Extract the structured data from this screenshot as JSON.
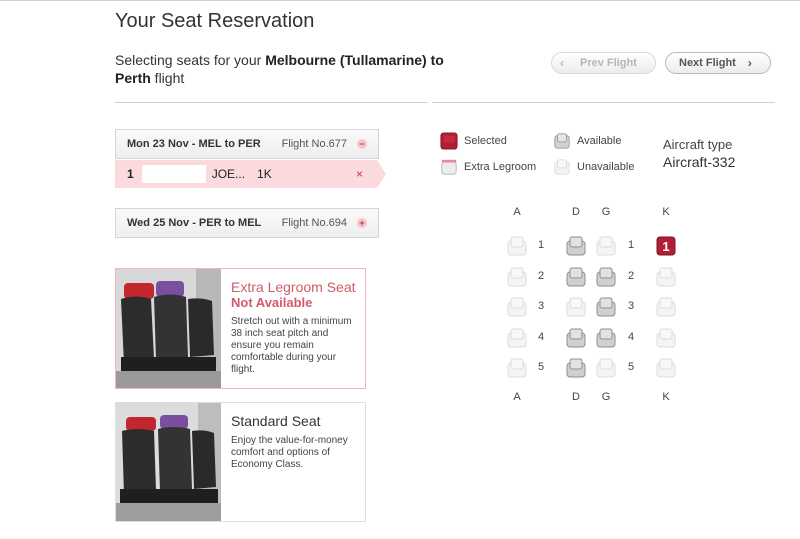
{
  "header": {
    "title": "Your Seat Reservation",
    "route_prefix": "Selecting seats for your ",
    "route_bold": "Melbourne (Tullamarine) to Perth",
    "route_suffix": " flight"
  },
  "nav": {
    "prev_label": "Prev Flight",
    "next_label": "Next Flight"
  },
  "flights": [
    {
      "route": "Mon 23 Nov - MEL to PER",
      "flight_no": "Flight No.677",
      "toggle": "−",
      "expanded": true
    },
    {
      "route": "Wed 25 Nov - PER to MEL",
      "flight_no": "Flight No.694",
      "toggle": "+",
      "expanded": false
    }
  ],
  "passenger": {
    "number": "1",
    "name": "JOE...",
    "seat": "1K",
    "remove": "×"
  },
  "cards": {
    "extra": {
      "title": "Extra Legroom Seat",
      "subtitle": "Not Available",
      "description": "Stretch out with a minimum 38 inch seat pitch and ensure you remain comfortable during your flight."
    },
    "standard": {
      "title": "Standard Seat",
      "description": "Enjoy the value-for-money comfort and options of Economy Class."
    }
  },
  "legend": {
    "selected": "Selected",
    "available": "Available",
    "extra_legroom": "Extra Legroom",
    "unavailable": "Unavailable"
  },
  "aircraft": {
    "label": "Aircraft type",
    "value": "Aircraft-332"
  },
  "seat_map": {
    "columns": [
      "A",
      "D",
      "G",
      "K"
    ],
    "rows": [
      {
        "number": "1",
        "seats": {
          "A": "unavailable",
          "D": "available",
          "G": "unavailable",
          "K": "selected"
        }
      },
      {
        "number": "2",
        "seats": {
          "A": "unavailable",
          "D": "available",
          "G": "available",
          "K": "unavailable"
        }
      },
      {
        "number": "3",
        "seats": {
          "A": "unavailable",
          "D": "unavailable",
          "G": "available",
          "K": "unavailable"
        }
      },
      {
        "number": "4",
        "seats": {
          "A": "unavailable",
          "D": "available",
          "G": "available",
          "K": "unavailable"
        }
      },
      {
        "number": "5",
        "seats": {
          "A": "unavailable",
          "D": "available",
          "G": "unavailable",
          "K": "unavailable"
        }
      }
    ],
    "selected_marker": "1"
  },
  "colors": {
    "accent": "#d35b6b",
    "selected": "#b01e34",
    "available": "#a9a9a9",
    "unavailable": "#e3e3e3",
    "pink_highlight": "#fbdadd"
  }
}
